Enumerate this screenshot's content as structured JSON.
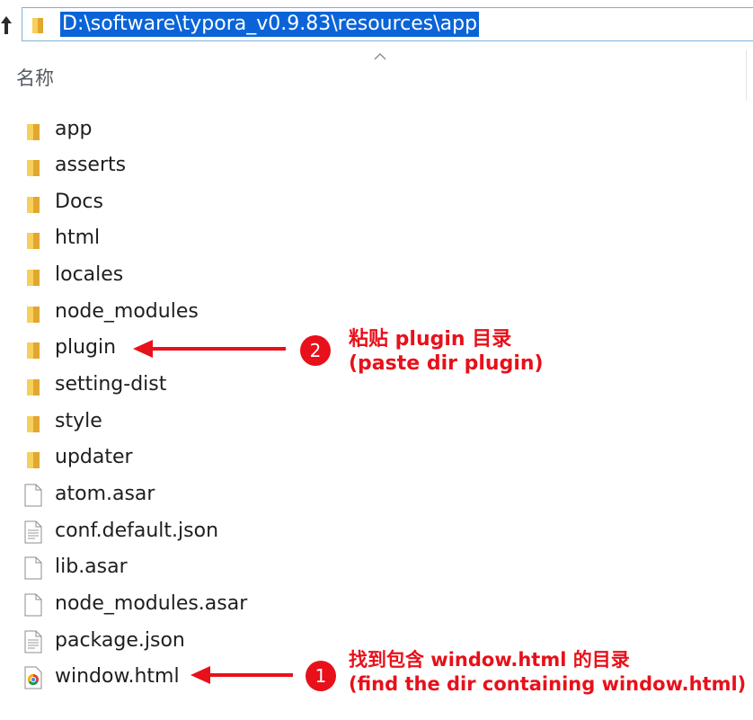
{
  "address_bar": {
    "path": "D:\\software\\typora_v0.9.83\\resources\\app"
  },
  "column_header": {
    "name_label": "名称"
  },
  "files": [
    {
      "name": "app",
      "icon": "folder-icon",
      "type": "folder"
    },
    {
      "name": "asserts",
      "icon": "folder-icon",
      "type": "folder"
    },
    {
      "name": "Docs",
      "icon": "folder-icon",
      "type": "folder"
    },
    {
      "name": "html",
      "icon": "folder-icon",
      "type": "folder"
    },
    {
      "name": "locales",
      "icon": "folder-icon",
      "type": "folder"
    },
    {
      "name": "node_modules",
      "icon": "folder-icon",
      "type": "folder"
    },
    {
      "name": "plugin",
      "icon": "folder-icon",
      "type": "folder"
    },
    {
      "name": "setting-dist",
      "icon": "folder-icon",
      "type": "folder"
    },
    {
      "name": "style",
      "icon": "folder-icon",
      "type": "folder"
    },
    {
      "name": "updater",
      "icon": "folder-icon",
      "type": "folder"
    },
    {
      "name": "atom.asar",
      "icon": "blank-file-icon",
      "type": "file"
    },
    {
      "name": "conf.default.json",
      "icon": "text-file-icon",
      "type": "file"
    },
    {
      "name": "lib.asar",
      "icon": "blank-file-icon",
      "type": "file"
    },
    {
      "name": "node_modules.asar",
      "icon": "blank-file-icon",
      "type": "file"
    },
    {
      "name": "package.json",
      "icon": "text-file-icon",
      "type": "file"
    },
    {
      "name": "window.html",
      "icon": "chrome-icon",
      "type": "file"
    }
  ],
  "annotations": [
    {
      "number": "2",
      "line1": "粘贴 plugin 目录",
      "line2": "(paste dir plugin)",
      "target": "plugin"
    },
    {
      "number": "1",
      "line1": "找到包含 window.html 的目录",
      "line2": "(find the dir containing window.html)",
      "target": "window.html"
    }
  ],
  "colors": {
    "selection": "#0a64d8",
    "annotation_red": "#e8101a",
    "folder_yellow": "#f4c24a"
  }
}
